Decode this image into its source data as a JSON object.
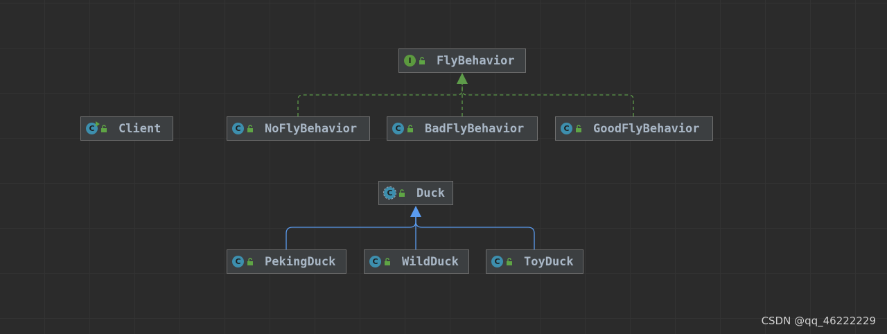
{
  "diagram": {
    "nodes": {
      "fly_behavior": {
        "label": "FlyBehavior",
        "kind": "interface",
        "icon": "interface-icon"
      },
      "client": {
        "label": "Client",
        "kind": "class",
        "icon": "class-main-icon"
      },
      "no_fly_behavior": {
        "label": "NoFlyBehavior",
        "kind": "class",
        "icon": "class-icon"
      },
      "bad_fly_behavior": {
        "label": "BadFlyBehavior",
        "kind": "class",
        "icon": "class-icon"
      },
      "good_fly_behavior": {
        "label": "GoodFlyBehavior",
        "kind": "class",
        "icon": "class-icon"
      },
      "duck": {
        "label": "Duck",
        "kind": "abstract-class",
        "icon": "abstract-class-icon"
      },
      "peking_duck": {
        "label": "PekingDuck",
        "kind": "class",
        "icon": "class-icon"
      },
      "wild_duck": {
        "label": "WildDuck",
        "kind": "class",
        "icon": "class-icon"
      },
      "toy_duck": {
        "label": "ToyDuck",
        "kind": "class",
        "icon": "class-icon"
      }
    },
    "relations": [
      {
        "from": "no_fly_behavior",
        "to": "fly_behavior",
        "type": "implements"
      },
      {
        "from": "bad_fly_behavior",
        "to": "fly_behavior",
        "type": "implements"
      },
      {
        "from": "good_fly_behavior",
        "to": "fly_behavior",
        "type": "implements"
      },
      {
        "from": "peking_duck",
        "to": "duck",
        "type": "extends"
      },
      {
        "from": "wild_duck",
        "to": "duck",
        "type": "extends"
      },
      {
        "from": "toy_duck",
        "to": "duck",
        "type": "extends"
      }
    ],
    "colors": {
      "background": "#2b2b2b",
      "node_fill": "#3c3f41",
      "node_border": "#707070",
      "label": "#a9b7c6",
      "implements_edge": "#5e9c4a",
      "extends_edge": "#5a9bef",
      "class_icon": "#3d8fae",
      "interface_icon": "#5c9a3f"
    }
  },
  "watermark": "CSDN @qq_46222229"
}
